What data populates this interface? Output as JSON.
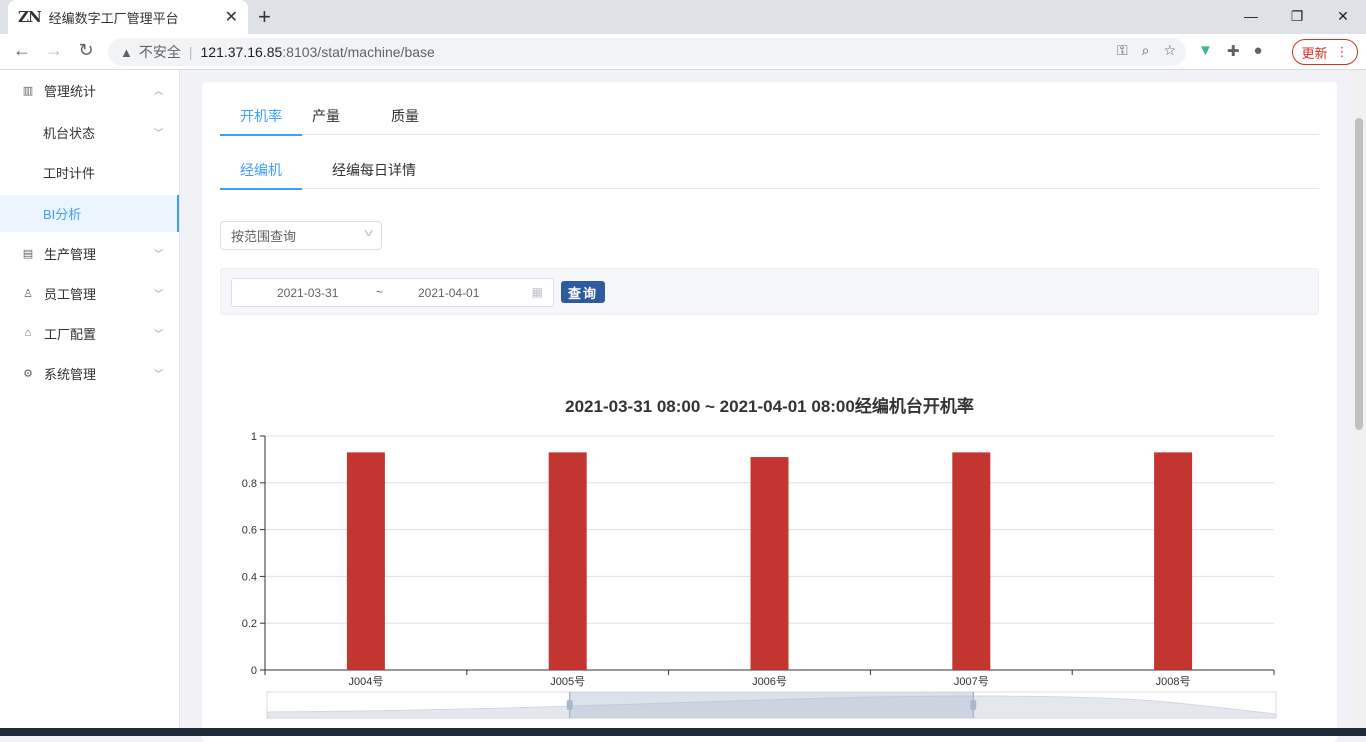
{
  "browser": {
    "tab_title": "经编数字工厂管理平台",
    "favicon_text": "ZN",
    "security_label": "不安全",
    "url_host": "121.37.16.85",
    "url_path": ":8103/stat/machine/base",
    "update_label": "更新"
  },
  "sidebar": {
    "items": [
      {
        "label": "管理统计",
        "icon": "bar-chart-icon"
      },
      {
        "label": "机台状态"
      },
      {
        "label": "工时计件"
      },
      {
        "label": "BI分析"
      },
      {
        "label": "生产管理",
        "icon": "document-icon"
      },
      {
        "label": "员工管理",
        "icon": "user-icon"
      },
      {
        "label": "工厂配置",
        "icon": "factory-icon"
      },
      {
        "label": "系统管理",
        "icon": "gear-icon"
      }
    ]
  },
  "main": {
    "top_tabs": [
      "开机率",
      "产量",
      "质量"
    ],
    "sub_tabs": [
      "经编机",
      "经编每日详情"
    ],
    "select_value": "按范围查询",
    "date_start": "2021-03-31",
    "date_sep": "~",
    "date_end": "2021-04-01",
    "query_label": "查询"
  },
  "chart_data": {
    "type": "bar",
    "title": "2021-03-31 08:00 ~ 2021-04-01 08:00经编机台开机率",
    "categories": [
      "J004号",
      "J005号",
      "J006号",
      "J007号",
      "J008号"
    ],
    "values": [
      0.93,
      0.93,
      0.91,
      0.93,
      0.93
    ],
    "ylim": [
      0,
      1
    ],
    "yticks": [
      0,
      0.2,
      0.4,
      0.6,
      0.8,
      1
    ],
    "grid": true,
    "bar_color": "#c23531"
  }
}
